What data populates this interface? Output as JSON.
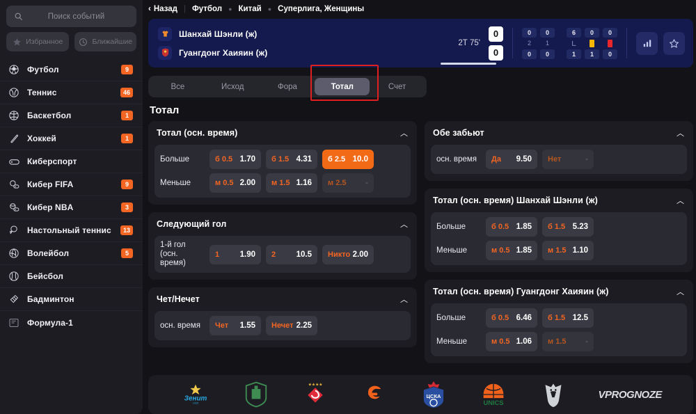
{
  "sidebar": {
    "search": {
      "placeholder": "Поиск событий",
      "icon": "search-icon"
    },
    "filters": [
      {
        "label": "Избранное",
        "icon": "star-icon"
      },
      {
        "label": "Ближайшие",
        "icon": "clock-icon"
      }
    ],
    "items": [
      {
        "label": "Футбол",
        "badge": "9",
        "icon": "soccer-ball-icon"
      },
      {
        "label": "Теннис",
        "badge": "46",
        "icon": "tennis-ball-icon"
      },
      {
        "label": "Баскетбол",
        "badge": "1",
        "icon": "basketball-icon"
      },
      {
        "label": "Хоккей",
        "badge": "1",
        "icon": "hockey-puck-icon"
      },
      {
        "label": "Киберспорт",
        "badge": "",
        "icon": "gamepad-icon"
      },
      {
        "label": "Кибер FIFA",
        "badge": "9",
        "icon": "cyber-fifa-icon"
      },
      {
        "label": "Кибер NBA",
        "badge": "3",
        "icon": "cyber-nba-icon"
      },
      {
        "label": "Настольный теннис",
        "badge": "13",
        "icon": "table-tennis-icon"
      },
      {
        "label": "Волейбол",
        "badge": "5",
        "icon": "volleyball-icon"
      },
      {
        "label": "Бейсбол",
        "badge": "",
        "icon": "baseball-icon"
      },
      {
        "label": "Бадминтон",
        "badge": "",
        "icon": "badminton-icon"
      },
      {
        "label": "Формула-1",
        "badge": "",
        "icon": "formula1-icon"
      }
    ]
  },
  "breadcrumb": {
    "back": "Назад",
    "items": [
      "Футбол",
      "Китай",
      "Суперлига, Женщины"
    ]
  },
  "match": {
    "home": {
      "name": "Шанхай Шэнли (ж)",
      "score": "0"
    },
    "away": {
      "name": "Гуангдонг Хаияин (ж)",
      "score": "0"
    },
    "time": "2Т 75'",
    "stats": [
      {
        "home": "0",
        "mid": "2",
        "away": "0"
      },
      {
        "home": "0",
        "mid": "1",
        "away": "0"
      },
      {
        "home": "6",
        "mid": "corner-icon",
        "away": "1"
      },
      {
        "home": "0",
        "mid": "yellow-card",
        "away": "1"
      },
      {
        "home": "0",
        "mid": "red-card",
        "away": "0"
      }
    ],
    "actions": [
      {
        "name": "statistics-button",
        "icon": "bar-chart-icon"
      },
      {
        "name": "favorite-button",
        "icon": "star-outline-icon"
      }
    ]
  },
  "tabs": [
    {
      "label": "Все",
      "active": false
    },
    {
      "label": "Исход",
      "active": false
    },
    {
      "label": "Фора",
      "active": false
    },
    {
      "label": "Тотал",
      "active": true
    },
    {
      "label": "Счет",
      "active": false
    }
  ],
  "section_title": "Тотал",
  "markets_left": [
    {
      "title": "Тотал (осн. время)",
      "rows": [
        {
          "label": "Больше",
          "odds": [
            {
              "key": "б 0.5",
              "value": "1.70",
              "selected": false
            },
            {
              "key": "б 1.5",
              "value": "4.31",
              "selected": false
            },
            {
              "key": "б 2.5",
              "value": "10.0",
              "selected": true
            }
          ]
        },
        {
          "label": "Меньше",
          "odds": [
            {
              "key": "м 0.5",
              "value": "2.00",
              "selected": false
            },
            {
              "key": "м 1.5",
              "value": "1.16",
              "selected": false
            },
            {
              "key": "м 2.5",
              "value": "-",
              "selected": false,
              "empty": true
            }
          ]
        }
      ]
    },
    {
      "title": "Следующий гол",
      "rows": [
        {
          "label": "1-й гол (осн. время)",
          "odds": [
            {
              "key": "1",
              "value": "1.90",
              "selected": false
            },
            {
              "key": "2",
              "value": "10.5",
              "selected": false
            },
            {
              "key": "Никто",
              "value": "2.00",
              "selected": false
            }
          ]
        }
      ]
    },
    {
      "title": "Чет/Нечет",
      "rows": [
        {
          "label": "осн. время",
          "odds": [
            {
              "key": "Чет",
              "value": "1.55",
              "selected": false
            },
            {
              "key": "Нечет",
              "value": "2.25",
              "selected": false
            }
          ]
        }
      ]
    }
  ],
  "markets_right": [
    {
      "title": "Обе забьют",
      "rows": [
        {
          "label": "осн. время",
          "odds": [
            {
              "key": "Да",
              "value": "9.50",
              "selected": false
            },
            {
              "key": "Нет",
              "value": "-",
              "selected": false,
              "empty": true
            }
          ]
        }
      ]
    },
    {
      "title": "Тотал (осн. время) Шанхай Шэнли (ж)",
      "rows": [
        {
          "label": "Больше",
          "odds": [
            {
              "key": "б 0.5",
              "value": "1.85",
              "selected": false
            },
            {
              "key": "б 1.5",
              "value": "5.23",
              "selected": false
            }
          ]
        },
        {
          "label": "Меньше",
          "odds": [
            {
              "key": "м 0.5",
              "value": "1.85",
              "selected": false
            },
            {
              "key": "м 1.5",
              "value": "1.10",
              "selected": false
            }
          ]
        }
      ]
    },
    {
      "title": "Тотал (осн. время) Гуангдонг Хаияин (ж)",
      "rows": [
        {
          "label": "Больше",
          "odds": [
            {
              "key": "б 0.5",
              "value": "6.46",
              "selected": false
            },
            {
              "key": "б 1.5",
              "value": "12.5",
              "selected": false
            }
          ]
        },
        {
          "label": "Меньше",
          "odds": [
            {
              "key": "м 0.5",
              "value": "1.06",
              "selected": false
            },
            {
              "key": "м 1.5",
              "value": "-",
              "selected": false,
              "empty": true
            }
          ]
        }
      ]
    }
  ],
  "footer": {
    "logos": [
      "Зенит",
      "Краснодар",
      "Спартак",
      "Euroleague",
      "ЦСКА",
      "UNICS",
      "Virtus.pro"
    ],
    "watermark": "VPROGNOZE"
  },
  "colors": {
    "accent": "#f26522",
    "selected": "#f26a16",
    "match_bg": "#141a4e",
    "panel": "#1c1c22",
    "highlight_border": "#e02020"
  }
}
